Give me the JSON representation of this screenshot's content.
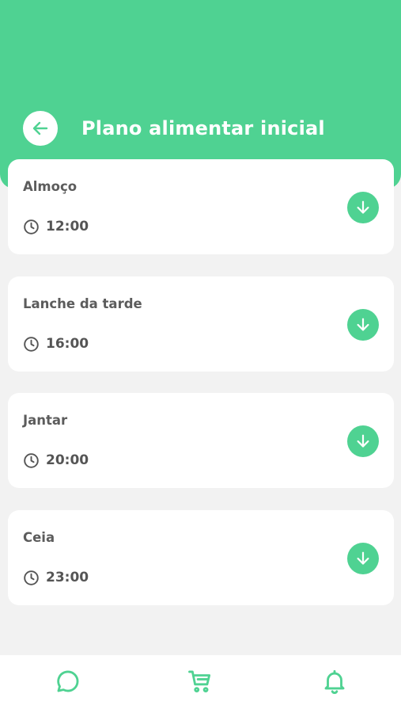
{
  "header": {
    "title": "Plano alimentar inicial",
    "back_icon": "arrow-left-icon"
  },
  "meals": [
    {
      "name": "Almoço",
      "time": "12:00"
    },
    {
      "name": "Lanche da tarde",
      "time": "16:00"
    },
    {
      "name": "Jantar",
      "time": "20:00"
    },
    {
      "name": "Ceia",
      "time": "23:00"
    }
  ],
  "bottom_nav": {
    "items": [
      "chat-bubble-icon",
      "shopping-cart-icon",
      "bell-icon"
    ]
  },
  "colors": {
    "accent": "#4fd292",
    "background": "#f2f2f2",
    "card": "#ffffff",
    "text": "#5c5c5c"
  }
}
